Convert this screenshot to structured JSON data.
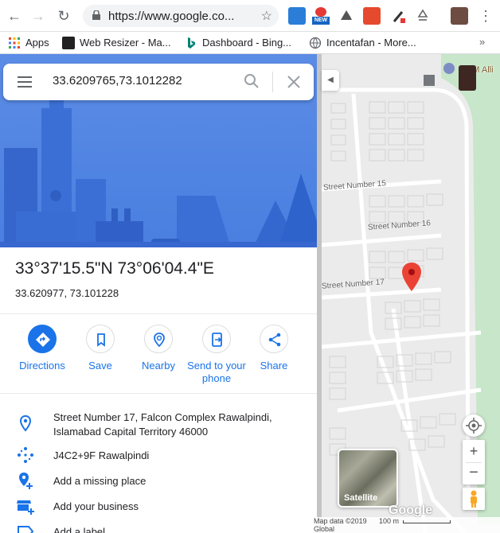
{
  "browser": {
    "url": "https://www.google.co...",
    "ext_new_badge": "NEW"
  },
  "bookmarks": [
    {
      "label": "Apps"
    },
    {
      "label": "Web Resizer - Ma..."
    },
    {
      "label": "Dashboard - Bing..."
    },
    {
      "label": "Incentafan - More..."
    }
  ],
  "search": {
    "value": "33.6209765,73.1012282"
  },
  "place": {
    "title": "33°37'15.5\"N 73°06'04.4\"E",
    "coords": "33.620977, 73.101228"
  },
  "actions": [
    {
      "label": "Directions"
    },
    {
      "label": "Save"
    },
    {
      "label": "Nearby"
    },
    {
      "label": "Send to your phone"
    },
    {
      "label": "Share"
    }
  ],
  "info": {
    "address": "Street Number 17, Falcon Complex Rawalpindi, Islamabad Capital Territory 46000",
    "plus_code": "J4C2+9F Rawalpindi",
    "add_missing_place": "Add a missing place",
    "add_business": "Add your business",
    "add_label": "Add a label"
  },
  "map": {
    "streets": [
      "Street Number 15",
      "Street Number 16",
      "Street Number 17"
    ],
    "poi_label": "ATM Alli",
    "satellite_label": "Satellite",
    "google_logo": "Google",
    "map_data": "Map data ©2019",
    "scale": "100 m",
    "global": "Global"
  },
  "colors": {
    "accent": "#1a73e8",
    "pin": "#ea4335",
    "hero": "#4a7fe0"
  }
}
